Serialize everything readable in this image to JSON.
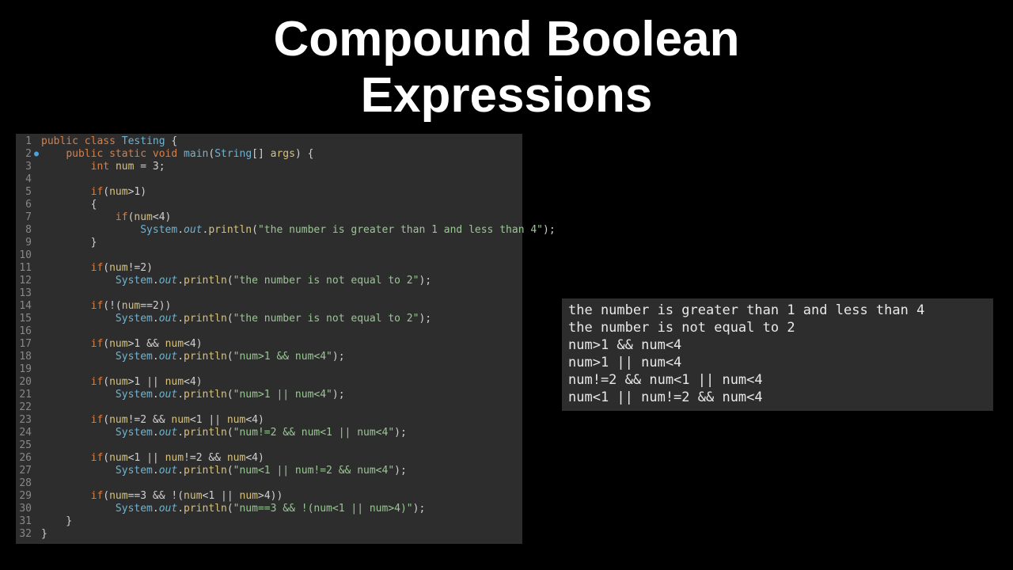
{
  "title_line1": "Compound Boolean",
  "title_line2": "Expressions",
  "code": {
    "lines": [
      {
        "n": "1",
        "bp": "",
        "tokens": [
          [
            "kw",
            "public"
          ],
          [
            "pln",
            " "
          ],
          [
            "kw",
            "class"
          ],
          [
            "pln",
            " "
          ],
          [
            "cls",
            "Testing"
          ],
          [
            "pln",
            " {"
          ]
        ]
      },
      {
        "n": "2",
        "bp": "●",
        "tokens": [
          [
            "pln",
            "    "
          ],
          [
            "kw",
            "public"
          ],
          [
            "pln",
            " "
          ],
          [
            "kw",
            "static"
          ],
          [
            "pln",
            " "
          ],
          [
            "kw",
            "void"
          ],
          [
            "pln",
            " "
          ],
          [
            "mth",
            "main"
          ],
          [
            "pln",
            "("
          ],
          [
            "cls",
            "String"
          ],
          [
            "pln",
            "[] "
          ],
          [
            "var",
            "args"
          ],
          [
            "pln",
            ") {"
          ]
        ]
      },
      {
        "n": "3",
        "bp": "",
        "tokens": [
          [
            "pln",
            "        "
          ],
          [
            "kw",
            "int"
          ],
          [
            "pln",
            " "
          ],
          [
            "var",
            "num"
          ],
          [
            "pln",
            " = "
          ],
          [
            "num",
            "3"
          ],
          [
            "pln",
            ";"
          ]
        ]
      },
      {
        "n": "4",
        "bp": "",
        "tokens": [
          [
            "pln",
            ""
          ]
        ]
      },
      {
        "n": "5",
        "bp": "",
        "tokens": [
          [
            "pln",
            "        "
          ],
          [
            "kw",
            "if"
          ],
          [
            "pln",
            "("
          ],
          [
            "var",
            "num"
          ],
          [
            "pln",
            ">"
          ],
          [
            "num",
            "1"
          ],
          [
            "pln",
            ")"
          ]
        ]
      },
      {
        "n": "6",
        "bp": "",
        "tokens": [
          [
            "pln",
            "        {"
          ]
        ]
      },
      {
        "n": "7",
        "bp": "",
        "tokens": [
          [
            "pln",
            "            "
          ],
          [
            "kw",
            "if"
          ],
          [
            "pln",
            "("
          ],
          [
            "var",
            "num"
          ],
          [
            "pln",
            "<"
          ],
          [
            "num",
            "4"
          ],
          [
            "pln",
            ")"
          ]
        ]
      },
      {
        "n": "8",
        "bp": "",
        "tokens": [
          [
            "pln",
            "                "
          ],
          [
            "sys",
            "System"
          ],
          [
            "pln",
            "."
          ],
          [
            "out",
            "out"
          ],
          [
            "pln",
            "."
          ],
          [
            "prn",
            "println"
          ],
          [
            "pln",
            "("
          ],
          [
            "str",
            "\"the number is greater than 1 and less than 4\""
          ],
          [
            "pln",
            ");"
          ]
        ]
      },
      {
        "n": "9",
        "bp": "",
        "tokens": [
          [
            "pln",
            "        }"
          ]
        ]
      },
      {
        "n": "10",
        "bp": "",
        "tokens": [
          [
            "pln",
            ""
          ]
        ]
      },
      {
        "n": "11",
        "bp": "",
        "tokens": [
          [
            "pln",
            "        "
          ],
          [
            "kw",
            "if"
          ],
          [
            "pln",
            "("
          ],
          [
            "var",
            "num"
          ],
          [
            "pln",
            "!="
          ],
          [
            "num",
            "2"
          ],
          [
            "pln",
            ")"
          ]
        ]
      },
      {
        "n": "12",
        "bp": "",
        "tokens": [
          [
            "pln",
            "            "
          ],
          [
            "sys",
            "System"
          ],
          [
            "pln",
            "."
          ],
          [
            "out",
            "out"
          ],
          [
            "pln",
            "."
          ],
          [
            "prn",
            "println"
          ],
          [
            "pln",
            "("
          ],
          [
            "str",
            "\"the number is not equal to 2\""
          ],
          [
            "pln",
            ");"
          ]
        ]
      },
      {
        "n": "13",
        "bp": "",
        "tokens": [
          [
            "pln",
            ""
          ]
        ]
      },
      {
        "n": "14",
        "bp": "",
        "tokens": [
          [
            "pln",
            "        "
          ],
          [
            "kw",
            "if"
          ],
          [
            "pln",
            "(!("
          ],
          [
            "var",
            "num"
          ],
          [
            "pln",
            "=="
          ],
          [
            "num",
            "2"
          ],
          [
            "pln",
            "))"
          ]
        ]
      },
      {
        "n": "15",
        "bp": "",
        "tokens": [
          [
            "pln",
            "            "
          ],
          [
            "sys",
            "System"
          ],
          [
            "pln",
            "."
          ],
          [
            "out",
            "out"
          ],
          [
            "pln",
            "."
          ],
          [
            "prn",
            "println"
          ],
          [
            "pln",
            "("
          ],
          [
            "str",
            "\"the number is not equal to 2\""
          ],
          [
            "pln",
            ");"
          ]
        ]
      },
      {
        "n": "16",
        "bp": "",
        "tokens": [
          [
            "pln",
            ""
          ]
        ]
      },
      {
        "n": "17",
        "bp": "",
        "tokens": [
          [
            "pln",
            "        "
          ],
          [
            "kw",
            "if"
          ],
          [
            "pln",
            "("
          ],
          [
            "var",
            "num"
          ],
          [
            "pln",
            ">"
          ],
          [
            "num",
            "1"
          ],
          [
            "pln",
            " && "
          ],
          [
            "var",
            "num"
          ],
          [
            "pln",
            "<"
          ],
          [
            "num",
            "4"
          ],
          [
            "pln",
            ")"
          ]
        ]
      },
      {
        "n": "18",
        "bp": "",
        "tokens": [
          [
            "pln",
            "            "
          ],
          [
            "sys",
            "System"
          ],
          [
            "pln",
            "."
          ],
          [
            "out",
            "out"
          ],
          [
            "pln",
            "."
          ],
          [
            "prn",
            "println"
          ],
          [
            "pln",
            "("
          ],
          [
            "str",
            "\"num>1 && num<4\""
          ],
          [
            "pln",
            ");"
          ]
        ]
      },
      {
        "n": "19",
        "bp": "",
        "tokens": [
          [
            "pln",
            ""
          ]
        ]
      },
      {
        "n": "20",
        "bp": "",
        "tokens": [
          [
            "pln",
            "        "
          ],
          [
            "kw",
            "if"
          ],
          [
            "pln",
            "("
          ],
          [
            "var",
            "num"
          ],
          [
            "pln",
            ">"
          ],
          [
            "num",
            "1"
          ],
          [
            "pln",
            " || "
          ],
          [
            "var",
            "num"
          ],
          [
            "pln",
            "<"
          ],
          [
            "num",
            "4"
          ],
          [
            "pln",
            ")"
          ]
        ]
      },
      {
        "n": "21",
        "bp": "",
        "tokens": [
          [
            "pln",
            "            "
          ],
          [
            "sys",
            "System"
          ],
          [
            "pln",
            "."
          ],
          [
            "out",
            "out"
          ],
          [
            "pln",
            "."
          ],
          [
            "prn",
            "println"
          ],
          [
            "pln",
            "("
          ],
          [
            "str",
            "\"num>1 || num<4\""
          ],
          [
            "pln",
            ");"
          ]
        ]
      },
      {
        "n": "22",
        "bp": "",
        "tokens": [
          [
            "pln",
            ""
          ]
        ]
      },
      {
        "n": "23",
        "bp": "",
        "tokens": [
          [
            "pln",
            "        "
          ],
          [
            "kw",
            "if"
          ],
          [
            "pln",
            "("
          ],
          [
            "var",
            "num"
          ],
          [
            "pln",
            "!="
          ],
          [
            "num",
            "2"
          ],
          [
            "pln",
            " && "
          ],
          [
            "var",
            "num"
          ],
          [
            "pln",
            "<"
          ],
          [
            "num",
            "1"
          ],
          [
            "pln",
            " || "
          ],
          [
            "var",
            "num"
          ],
          [
            "pln",
            "<"
          ],
          [
            "num",
            "4"
          ],
          [
            "pln",
            ")"
          ]
        ]
      },
      {
        "n": "24",
        "bp": "",
        "tokens": [
          [
            "pln",
            "            "
          ],
          [
            "sys",
            "System"
          ],
          [
            "pln",
            "."
          ],
          [
            "out",
            "out"
          ],
          [
            "pln",
            "."
          ],
          [
            "prn",
            "println"
          ],
          [
            "pln",
            "("
          ],
          [
            "str",
            "\"num!=2 && num<1 || num<4\""
          ],
          [
            "pln",
            ");"
          ]
        ]
      },
      {
        "n": "25",
        "bp": "",
        "tokens": [
          [
            "pln",
            ""
          ]
        ]
      },
      {
        "n": "26",
        "bp": "",
        "tokens": [
          [
            "pln",
            "        "
          ],
          [
            "kw",
            "if"
          ],
          [
            "pln",
            "("
          ],
          [
            "var",
            "num"
          ],
          [
            "pln",
            "<"
          ],
          [
            "num",
            "1"
          ],
          [
            "pln",
            " || "
          ],
          [
            "var",
            "num"
          ],
          [
            "pln",
            "!="
          ],
          [
            "num",
            "2"
          ],
          [
            "pln",
            " && "
          ],
          [
            "var",
            "num"
          ],
          [
            "pln",
            "<"
          ],
          [
            "num",
            "4"
          ],
          [
            "pln",
            ")"
          ]
        ]
      },
      {
        "n": "27",
        "bp": "",
        "tokens": [
          [
            "pln",
            "            "
          ],
          [
            "sys",
            "System"
          ],
          [
            "pln",
            "."
          ],
          [
            "out",
            "out"
          ],
          [
            "pln",
            "."
          ],
          [
            "prn",
            "println"
          ],
          [
            "pln",
            "("
          ],
          [
            "str",
            "\"num<1 || num!=2 && num<4\""
          ],
          [
            "pln",
            ");"
          ]
        ]
      },
      {
        "n": "28",
        "bp": "",
        "tokens": [
          [
            "pln",
            ""
          ]
        ]
      },
      {
        "n": "29",
        "bp": "",
        "tokens": [
          [
            "pln",
            "        "
          ],
          [
            "kw",
            "if"
          ],
          [
            "pln",
            "("
          ],
          [
            "var",
            "num"
          ],
          [
            "pln",
            "=="
          ],
          [
            "num",
            "3"
          ],
          [
            "pln",
            " && !("
          ],
          [
            "var",
            "num"
          ],
          [
            "pln",
            "<"
          ],
          [
            "num",
            "1"
          ],
          [
            "pln",
            " || "
          ],
          [
            "var",
            "num"
          ],
          [
            "pln",
            ">"
          ],
          [
            "num",
            "4"
          ],
          [
            "pln",
            "))"
          ]
        ]
      },
      {
        "n": "30",
        "bp": "",
        "tokens": [
          [
            "pln",
            "            "
          ],
          [
            "sys",
            "System"
          ],
          [
            "pln",
            "."
          ],
          [
            "out",
            "out"
          ],
          [
            "pln",
            "."
          ],
          [
            "prn",
            "println"
          ],
          [
            "pln",
            "("
          ],
          [
            "str",
            "\"num==3 && !(num<1 || num>4)\""
          ],
          [
            "pln",
            ");"
          ]
        ]
      },
      {
        "n": "31",
        "bp": "",
        "tokens": [
          [
            "pln",
            "    }"
          ]
        ]
      },
      {
        "n": "32",
        "bp": "",
        "tokens": [
          [
            "pln",
            "}"
          ]
        ]
      }
    ]
  },
  "output": [
    "the number is greater than 1 and less than 4",
    "the number is not equal to 2",
    "num>1 && num<4",
    "num>1 || num<4",
    "num!=2 && num<1 || num<4",
    "num<1 || num!=2 && num<4"
  ]
}
